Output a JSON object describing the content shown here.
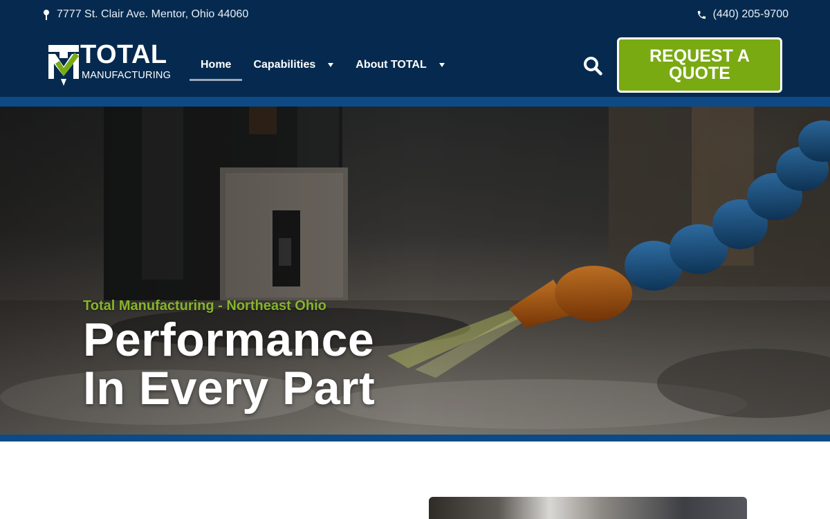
{
  "topbar": {
    "address": "7777 St. Clair Ave. Mentor, Ohio 44060",
    "address_icon": "map-pin-icon",
    "phone": "(440) 205-9700",
    "phone_icon": "phone-icon"
  },
  "logo": {
    "word_main": "TOTAL",
    "word_sub": "MANUFACTURING"
  },
  "nav": {
    "items": [
      {
        "label": "Home",
        "active": true,
        "has_dropdown": false
      },
      {
        "label": "Capabilities",
        "active": false,
        "has_dropdown": true
      },
      {
        "label": "About TOTAL",
        "active": false,
        "has_dropdown": true
      }
    ]
  },
  "search_icon": "search-icon",
  "cta": {
    "label": "REQUEST A QUOTE"
  },
  "hero": {
    "subtitle": "Total Manufacturing - Northeast Ohio",
    "title_line1": "Performance",
    "title_line2": "In Every Part"
  },
  "colors": {
    "header_bg": "#062a4f",
    "accent_blue": "#0d4a86",
    "brand_green": "#79aa12",
    "subtitle_green": "#86b52a",
    "text_white": "#ffffff"
  }
}
